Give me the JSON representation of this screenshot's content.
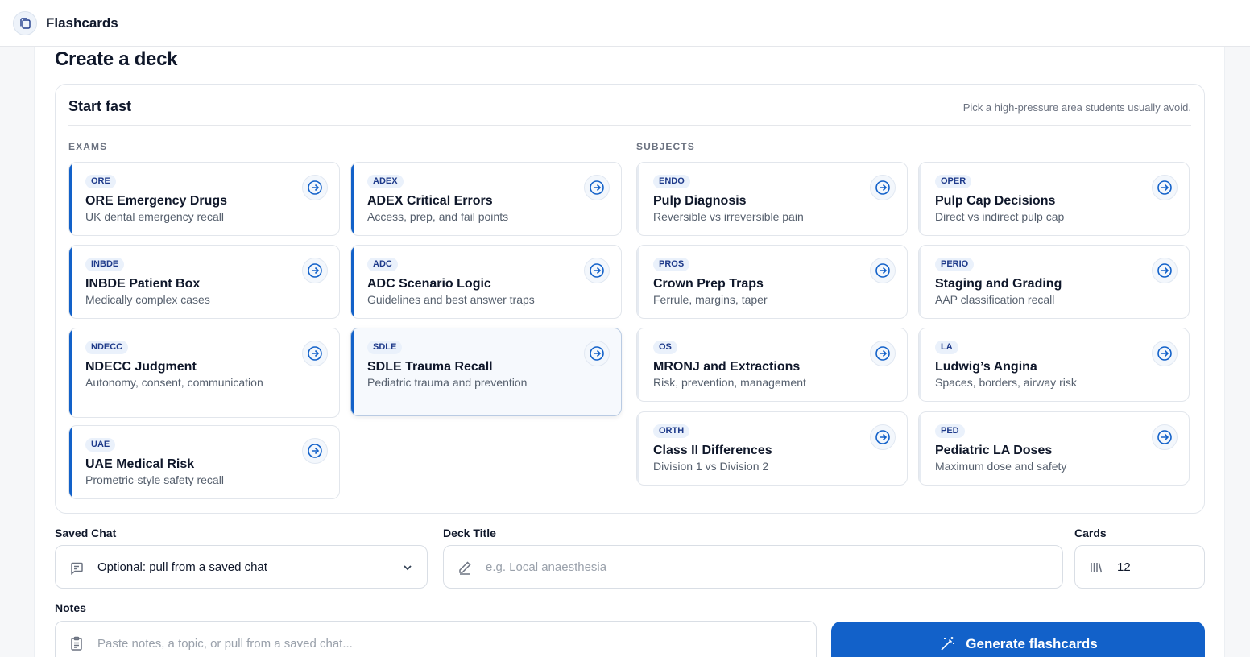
{
  "app": {
    "title": "Flashcards",
    "icon": "copy-cards-icon"
  },
  "page": {
    "title": "Create a deck"
  },
  "start_fast": {
    "title": "Start fast",
    "hint": "Pick a high-pressure area students usually avoid.",
    "exams_label": "EXAMS",
    "subjects_label": "SUBJECTS",
    "exams": [
      {
        "badge": "ORE",
        "title": "ORE Emergency Drugs",
        "subtitle": "UK dental emergency recall"
      },
      {
        "badge": "ADEX",
        "title": "ADEX Critical Errors",
        "subtitle": "Access, prep, and fail points"
      },
      {
        "badge": "INBDE",
        "title": "INBDE Patient Box",
        "subtitle": "Medically complex cases"
      },
      {
        "badge": "ADC",
        "title": "ADC Scenario Logic",
        "subtitle": "Guidelines and best answer traps"
      },
      {
        "badge": "NDECC",
        "title": "NDECC Judgment",
        "subtitle": "Autonomy, consent, communication"
      },
      {
        "badge": "SDLE",
        "title": "SDLE Trauma Recall",
        "subtitle": "Pediatric trauma and prevention"
      },
      {
        "badge": "UAE",
        "title": "UAE Medical Risk",
        "subtitle": "Prometric-style safety recall"
      }
    ],
    "subjects": [
      {
        "badge": "ENDO",
        "title": "Pulp Diagnosis",
        "subtitle": "Reversible vs irreversible pain"
      },
      {
        "badge": "OPER",
        "title": "Pulp Cap Decisions",
        "subtitle": "Direct vs indirect pulp cap"
      },
      {
        "badge": "PROS",
        "title": "Crown Prep Traps",
        "subtitle": "Ferrule, margins, taper"
      },
      {
        "badge": "PERIO",
        "title": "Staging and Grading",
        "subtitle": "AAP classification recall"
      },
      {
        "badge": "OS",
        "title": "MRONJ and Extractions",
        "subtitle": "Risk, prevention, management"
      },
      {
        "badge": "LA",
        "title": "Ludwig’s Angina",
        "subtitle": "Spaces, borders, airway risk"
      },
      {
        "badge": "ORTH",
        "title": "Class II Differences",
        "subtitle": "Division 1 vs Division 2"
      },
      {
        "badge": "PED",
        "title": "Pediatric LA Doses",
        "subtitle": "Maximum dose and safety"
      }
    ]
  },
  "form": {
    "saved_chat": {
      "label": "Saved Chat",
      "value": "Optional: pull from a saved chat"
    },
    "deck_title": {
      "label": "Deck Title",
      "placeholder": "e.g. Local anaesthesia"
    },
    "cards": {
      "label": "Cards",
      "value": "12"
    },
    "notes": {
      "label": "Notes",
      "placeholder": "Paste notes, a topic, or pull from a saved chat..."
    },
    "generate_label": "Generate flashcards"
  },
  "colors": {
    "accent": "#1261c9",
    "badge_bg": "#eaf1fb",
    "badge_text": "#1e3a8a"
  }
}
